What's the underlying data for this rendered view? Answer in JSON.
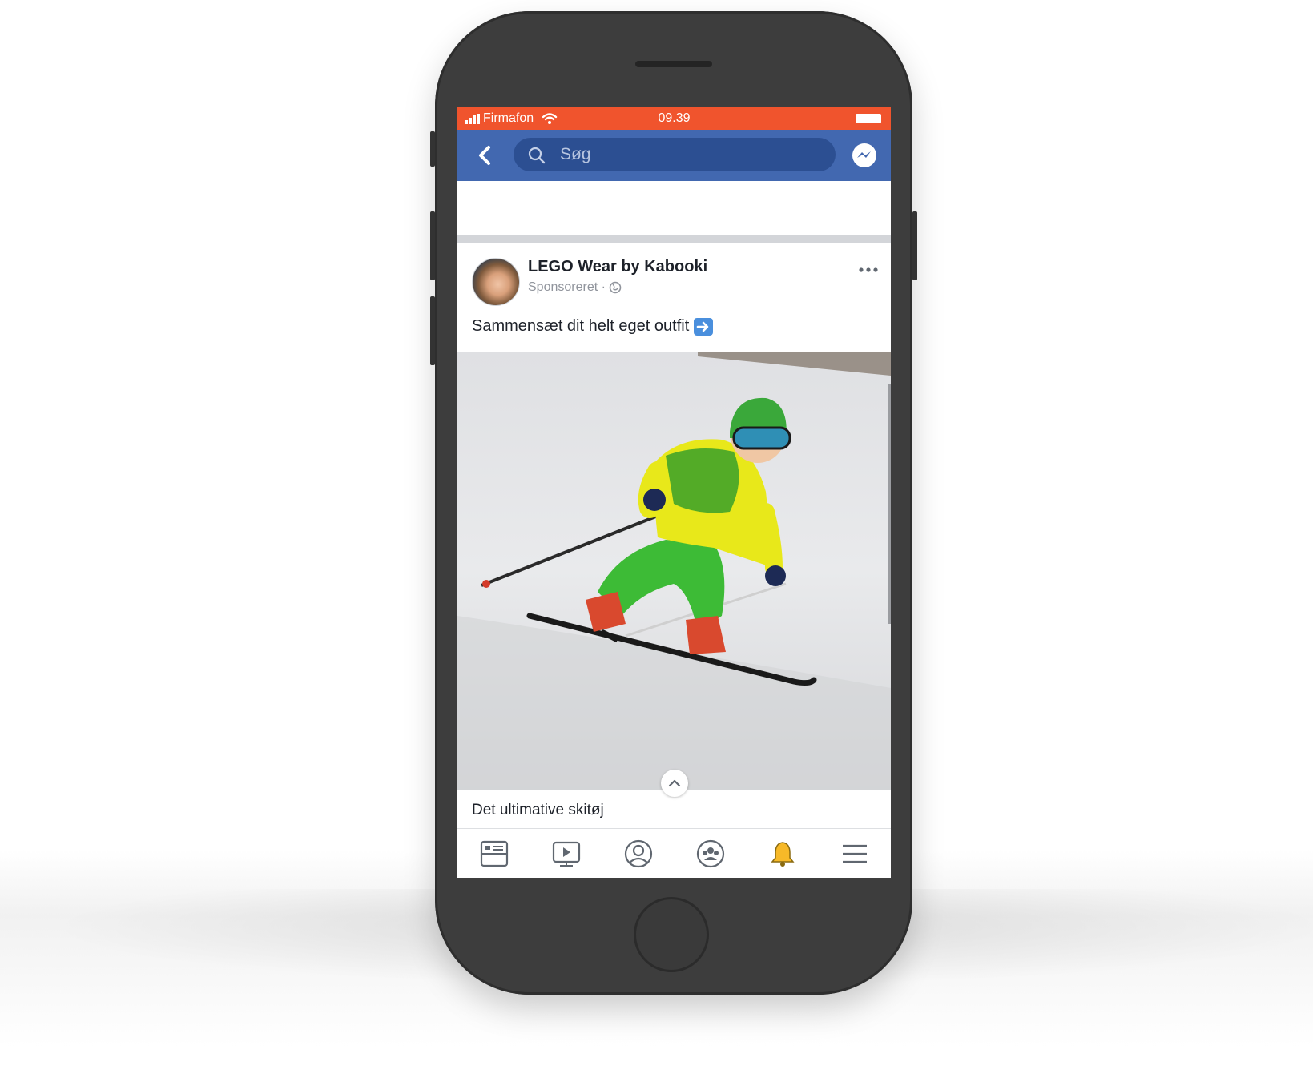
{
  "status_bar": {
    "carrier": "Firmafon",
    "time": "09.39"
  },
  "nav": {
    "search_placeholder": "Søg"
  },
  "post": {
    "page_name": "LEGO Wear by Kabooki",
    "sponsored_label": "Sponsoreret ·",
    "text": "Sammensæt dit helt eget outfit",
    "caption_title": "Det ultimative skitøj"
  },
  "tabs": [
    {
      "name": "news-feed",
      "icon": "news-feed-icon"
    },
    {
      "name": "watch",
      "icon": "video-icon"
    },
    {
      "name": "profile",
      "icon": "profile-icon"
    },
    {
      "name": "groups",
      "icon": "groups-icon"
    },
    {
      "name": "notifications",
      "icon": "bell-icon"
    },
    {
      "name": "menu",
      "icon": "menu-icon"
    }
  ],
  "colors": {
    "status_bar": "#f0542d",
    "nav_bar": "#4268b0",
    "search_box": "#2c4f92",
    "phone_body": "#3d3d3d",
    "bell": "#f7b928"
  }
}
